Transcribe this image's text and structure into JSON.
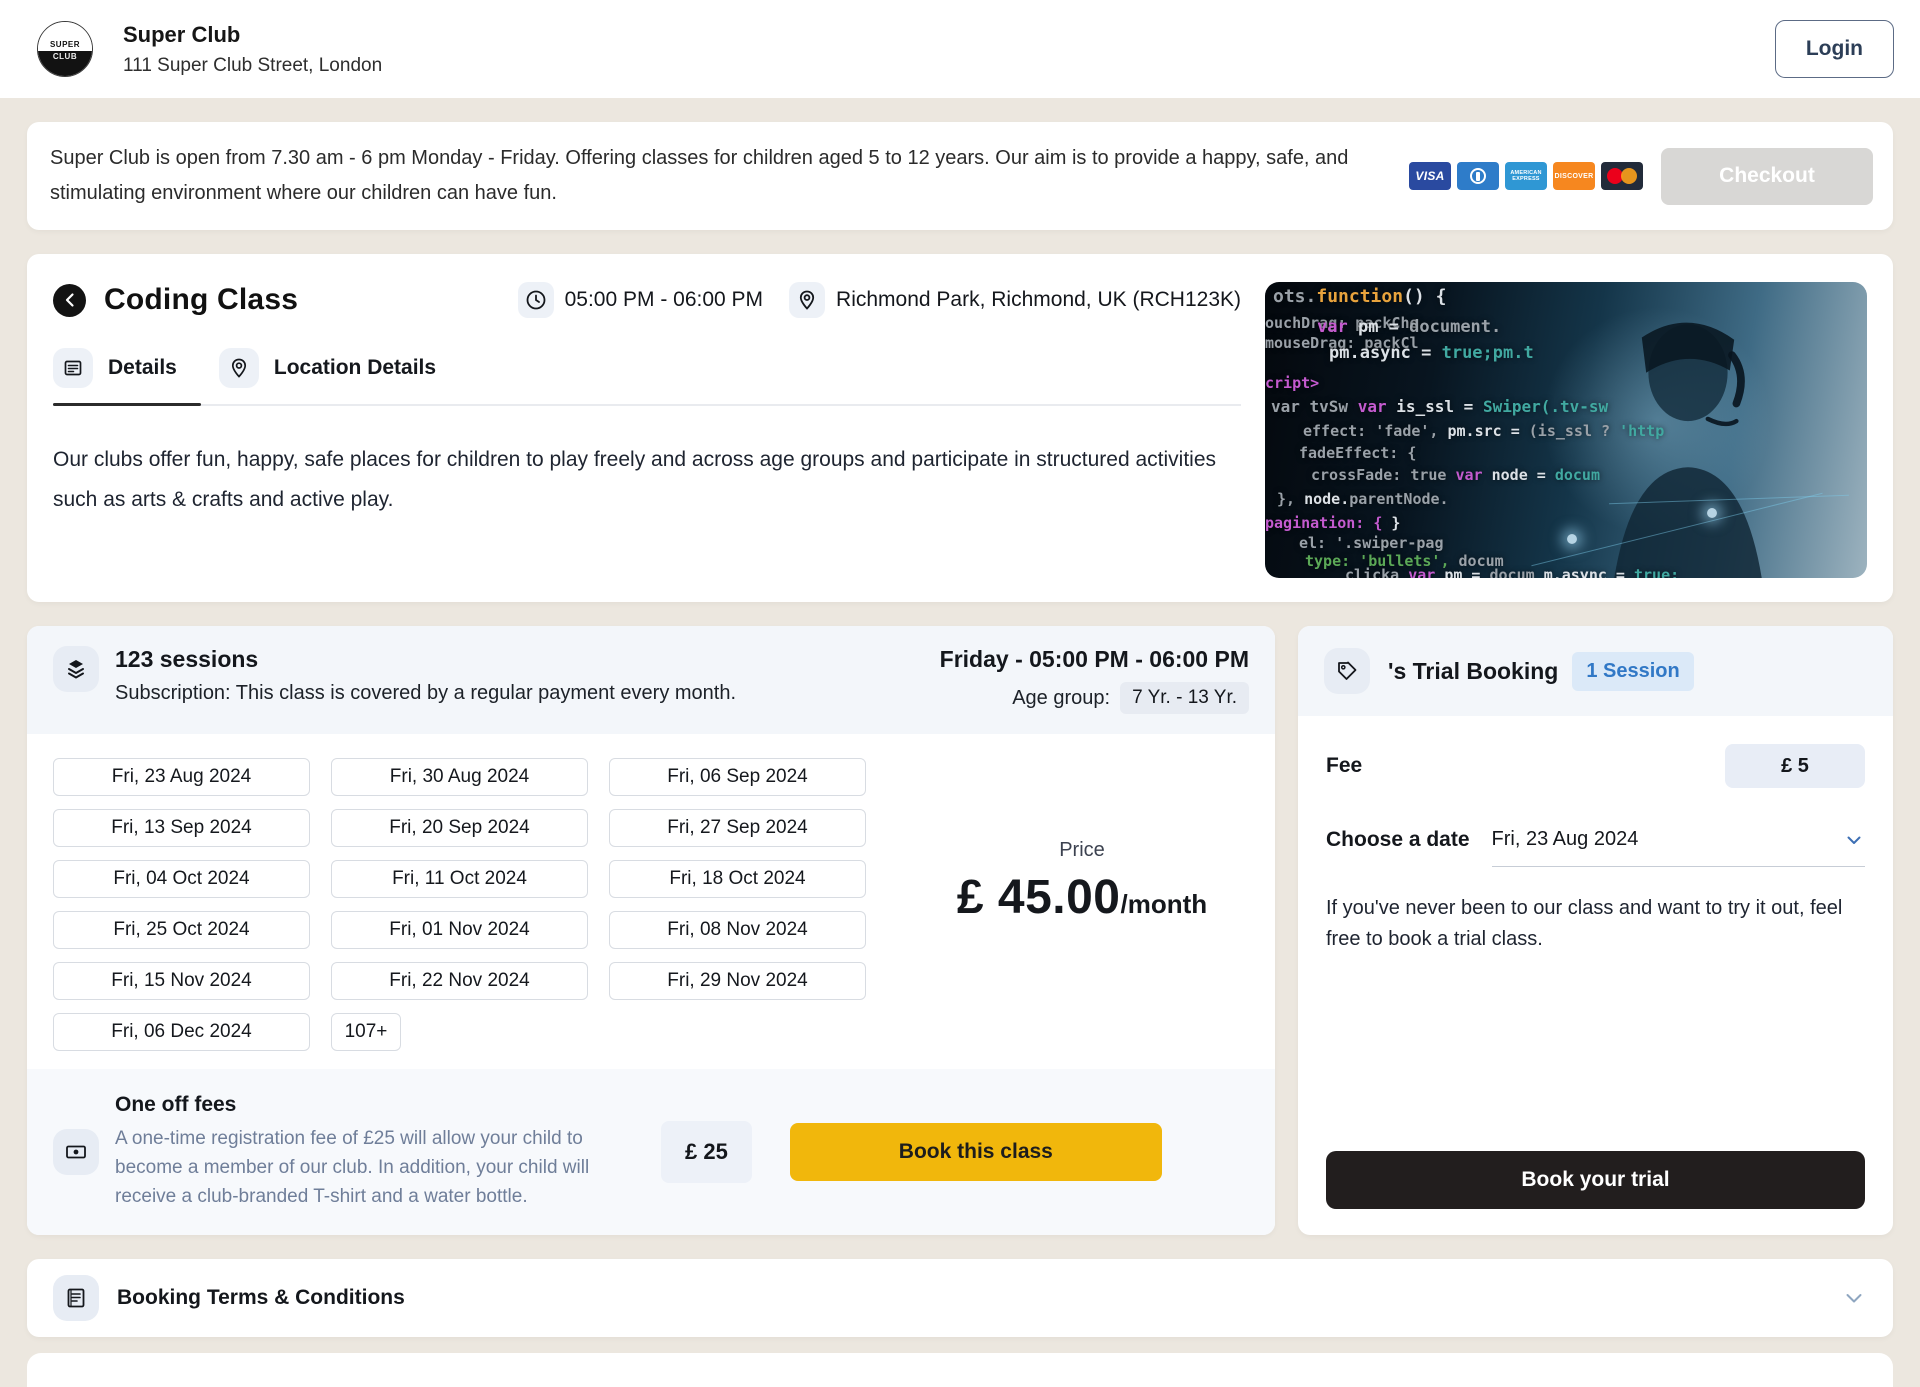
{
  "header": {
    "logo_top": "SUPER",
    "logo_bottom": "CLUB",
    "club_name": "Super Club",
    "club_address": "111 Super Club Street, London",
    "login_label": "Login"
  },
  "banner": {
    "text": "Super Club is open from 7.30 am - 6 pm Monday - Friday. Offering classes for children aged 5 to 12 years. Our aim is to provide a happy, safe, and stimulating environment where our children can have fun.",
    "payment_methods": [
      {
        "name": "visa",
        "label": "VISA"
      },
      {
        "name": "diners",
        "label": "Diners Club"
      },
      {
        "name": "amex",
        "label": "AMERICAN EXPRESS"
      },
      {
        "name": "discover",
        "label": "DISCOVER"
      },
      {
        "name": "mastercard",
        "label": "Mastercard"
      }
    ],
    "checkout_label": "Checkout"
  },
  "class_card": {
    "title": "Coding Class",
    "time": "05:00 PM - 06:00 PM",
    "location": "Richmond Park, Richmond, UK (RCH123K)",
    "tabs": [
      {
        "label": "Details",
        "active": true
      },
      {
        "label": "Location Details",
        "active": false
      }
    ],
    "description": "Our clubs offer fun, happy, safe places for children to play freely and across age groups and participate in structured activities such as arts & crafts and active play.",
    "photo_code_lines": [
      [
        {
          "t": "ots.",
          "c": "gray"
        },
        {
          "t": "function",
          "c": "orange"
        },
        {
          "t": "() {",
          "c": "white"
        }
      ],
      [
        {
          "t": "ouchDrag: packChe",
          "c": "gray"
        }
      ],
      [
        {
          "t": "var",
          "c": "magenta"
        },
        {
          "t": " pm = ",
          "c": "white"
        },
        {
          "t": "document.",
          "c": "gray"
        }
      ],
      [
        {
          "t": "mouseDrag: packCl",
          "c": "gray"
        }
      ],
      [
        {
          "t": "pm.async = ",
          "c": "white"
        },
        {
          "t": "true;pm.t",
          "c": "teal"
        }
      ],
      [
        {
          "t": "cript>",
          "c": "magenta"
        }
      ],
      [
        {
          "t": "var tvSw ",
          "c": "gray"
        },
        {
          "t": "var",
          "c": "magenta"
        },
        {
          "t": " is_ssl = ",
          "c": "white"
        },
        {
          "t": "Swiper(.tv-sw",
          "c": "teal"
        }
      ],
      [
        {
          "t": "effect: 'fade',  ",
          "c": "gray"
        },
        {
          "t": "pm.src = ",
          "c": "white"
        },
        {
          "t": "(is_ssl ? ",
          "c": "gray"
        },
        {
          "t": "'http",
          "c": "teal"
        }
      ],
      [
        {
          "t": "fadeEffect: {",
          "c": "gray"
        }
      ],
      [
        {
          "t": "crossFade: true   ",
          "c": "gray"
        },
        {
          "t": "var",
          "c": "magenta"
        },
        {
          "t": " node = ",
          "c": "white"
        },
        {
          "t": "docum",
          "c": "teal"
        }
      ],
      [
        {
          "t": "},",
          "c": "gray"
        },
        {
          "t": "      node.",
          "c": "white"
        },
        {
          "t": "parentNode.",
          "c": "gray"
        }
      ],
      [
        {
          "t": "pagination: {",
          "c": "magenta"
        },
        {
          "t": "  }",
          "c": "white"
        }
      ],
      [
        {
          "t": "el: '.swiper-pag",
          "c": "gray"
        }
      ],
      [
        {
          "t": "type: 'bullets',",
          "c": "green"
        },
        {
          "t": "  docum",
          "c": "gray"
        }
      ],
      [
        {
          "t": "clicka ",
          "c": "gray"
        },
        {
          "t": "var",
          "c": "magenta"
        },
        {
          "t": " pm = ",
          "c": "white"
        },
        {
          "t": "docum  ",
          "c": "gray"
        },
        {
          "t": "m.async = ",
          "c": "white"
        },
        {
          "t": "true;",
          "c": "teal"
        }
      ]
    ]
  },
  "sessions_panel": {
    "title": "123 sessions",
    "subtitle": "Subscription: This class is covered by a regular payment every month.",
    "schedule": "Friday - 05:00 PM - 06:00 PM",
    "age_group_label": "Age group:",
    "age_group_value": "7 Yr. - 13 Yr.",
    "dates": [
      "Fri, 23 Aug 2024",
      "Fri, 30 Aug 2024",
      "Fri, 06 Sep 2024",
      "Fri, 13 Sep 2024",
      "Fri, 20 Sep 2024",
      "Fri, 27 Sep 2024",
      "Fri, 04 Oct 2024",
      "Fri, 11 Oct 2024",
      "Fri, 18 Oct 2024",
      "Fri, 25 Oct 2024",
      "Fri, 01 Nov 2024",
      "Fri, 08 Nov 2024",
      "Fri, 15 Nov 2024",
      "Fri, 22 Nov 2024",
      "Fri, 29 Nov 2024",
      "Fri, 06 Dec 2024"
    ],
    "more_label": "107+",
    "price_label": "Price",
    "price_amount": "£ 45.00",
    "price_period": "/month",
    "one_off": {
      "title": "One off fees",
      "description": "A one-time registration fee of £25 will allow your child to become a member of our club. In addition, your child will receive a club-branded T-shirt and a water bottle.",
      "fee_value": "£ 25",
      "book_label": "Book this class"
    }
  },
  "trial_panel": {
    "title": "'s Trial Booking",
    "badge": "1 Session",
    "fee_label": "Fee",
    "fee_value": "£ 5",
    "date_label": "Choose a date",
    "date_value": "Fri, 23 Aug 2024",
    "note": "If you've never been to our class and want to try it out, feel free to book a trial class.",
    "book_label": "Book your trial"
  },
  "terms": {
    "label": "Booking Terms & Conditions"
  },
  "colors": {
    "page_background": "#ECE7DF",
    "accent_yellow": "#F1B70C",
    "accent_dark_button": "#221E1E",
    "badge_blue_text": "#3178C6",
    "badge_blue_bg": "#DBE9F8",
    "panel_header_bg": "#F3F6FA",
    "checkout_disabled_bg": "#D8D7D5"
  }
}
